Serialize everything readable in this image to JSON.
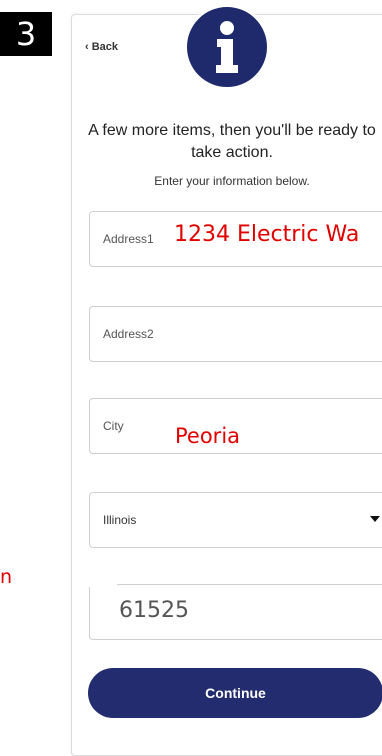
{
  "step_number": "3",
  "side_note": "n",
  "back_link": "‹ Back",
  "info_icon": "info-icon",
  "headline": "A few more items, then you'll be ready to take action.",
  "subline": "Enter your information below.",
  "fields": {
    "address1": {
      "label": "Address1",
      "annotation": "1234 Electric Wa"
    },
    "address2": {
      "label": "Address2"
    },
    "city": {
      "label": "City",
      "annotation": "Peoria"
    },
    "state": {
      "value": "Illinois"
    },
    "zip": {
      "value": "61525"
    }
  },
  "continue_label": "Continue",
  "colors": {
    "primary": "#232c6f",
    "annotation": "#e00000"
  }
}
